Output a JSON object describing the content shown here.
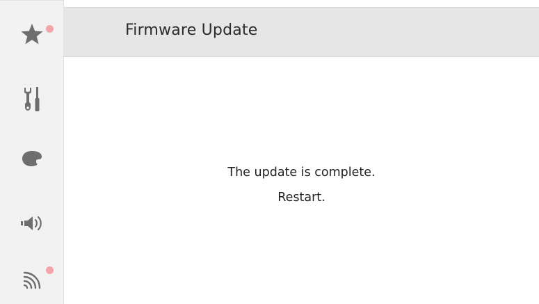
{
  "header": {
    "title": "Firmware Update"
  },
  "sidebar": {
    "items": [
      {
        "name": "favorites",
        "icon": "star-icon",
        "badge": true
      },
      {
        "name": "tools",
        "icon": "wrench-screwdriver-icon",
        "badge": false
      },
      {
        "name": "appearance",
        "icon": "palette-icon",
        "badge": false
      },
      {
        "name": "sound",
        "icon": "speaker-icon",
        "badge": false
      },
      {
        "name": "network",
        "icon": "wireless-icon",
        "badge": true
      }
    ]
  },
  "message": {
    "line1": "The update is complete.",
    "line2": "Restart."
  },
  "colors": {
    "sidebar_bg": "#f2f2f2",
    "header_bg": "#e6e6e6",
    "icon": "#6e6e6e",
    "badge": "#f2a6aa",
    "text": "#1f1f1f"
  }
}
